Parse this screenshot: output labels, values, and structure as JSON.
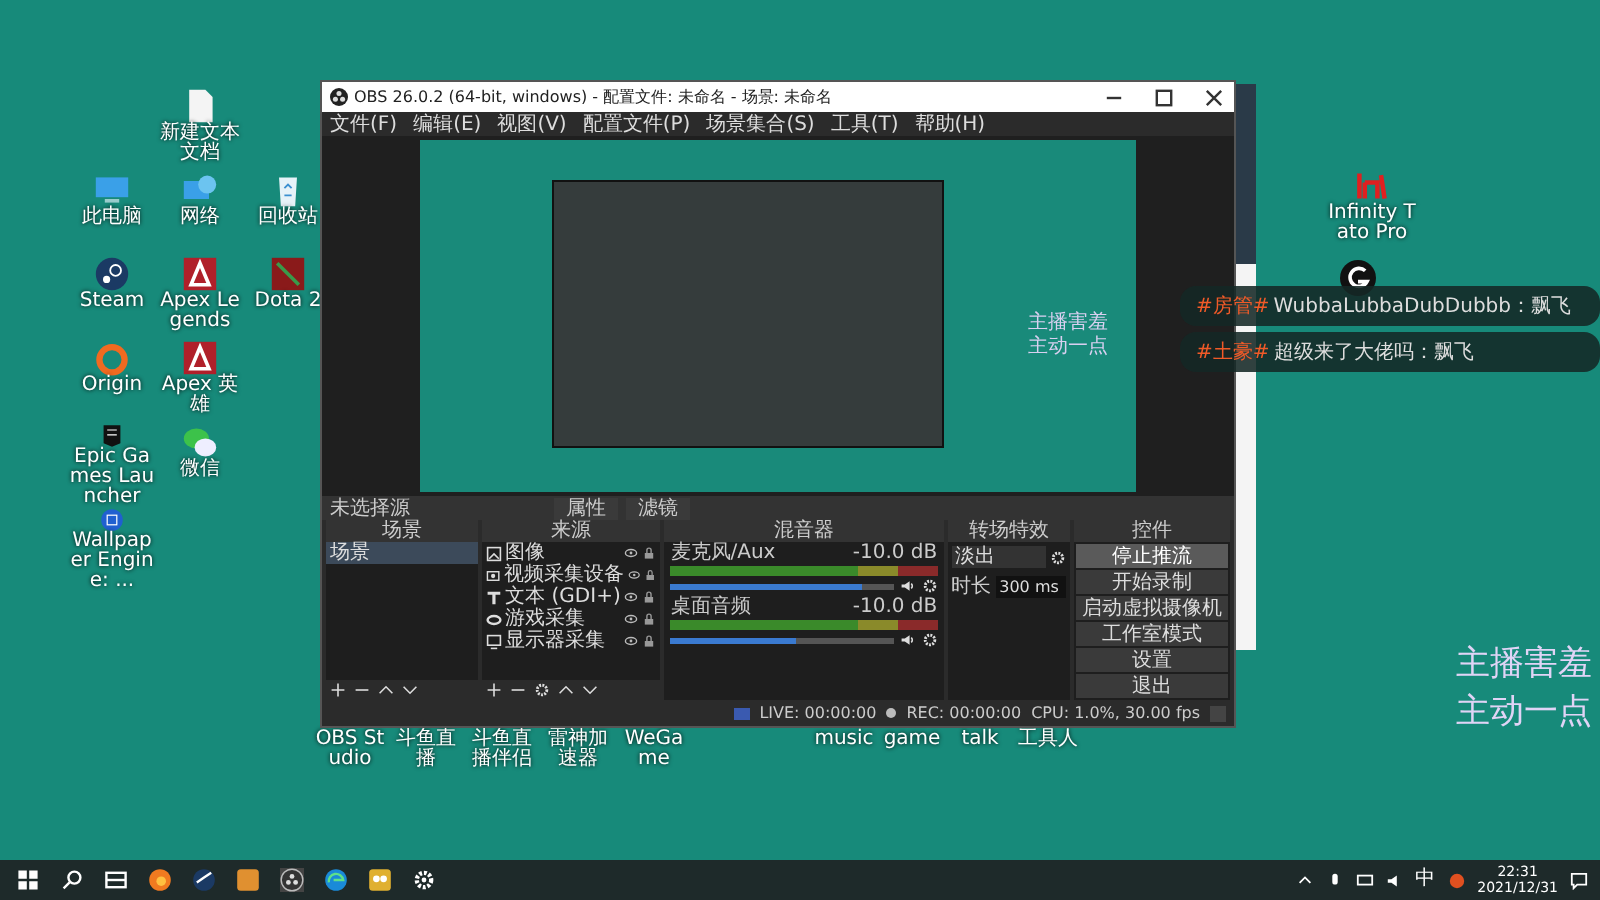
{
  "desktop_icons": [
    {
      "label": "新建文本文档",
      "kind": "file"
    },
    {
      "label": "此电脑",
      "kind": "pc"
    },
    {
      "label": "网络",
      "kind": "network"
    },
    {
      "label": "回收站",
      "kind": "recycle"
    },
    {
      "label": "Steam",
      "kind": "steam"
    },
    {
      "label": "Apex Legends",
      "kind": "apex"
    },
    {
      "label": "Dota 2",
      "kind": "dota"
    },
    {
      "label": "Origin",
      "kind": "origin"
    },
    {
      "label": "Apex 英雄",
      "kind": "apex"
    },
    {
      "label": "Epic Games Launcher",
      "kind": "epic"
    },
    {
      "label": "微信",
      "kind": "wechat"
    },
    {
      "label": "Wallpaper Engine: ...",
      "kind": "wallpaper"
    }
  ],
  "right_icons": [
    {
      "label": "Infinity Tato Pro",
      "kind": "itp"
    },
    {
      "kind": "ghub"
    }
  ],
  "bottom_labels_left": [
    "OBS Studio",
    "斗鱼直播",
    "斗鱼直播伴侣",
    "雷神加速器",
    "WeGame"
  ],
  "bottom_labels_right": [
    "music",
    "game",
    "talk",
    "工具人"
  ],
  "obs": {
    "title": "OBS 26.0.2 (64-bit, windows) - 配置文件: 未命名 - 场景: 未命名",
    "menu": [
      "文件(F)",
      "编辑(E)",
      "视图(V)",
      "配置文件(P)",
      "场景集合(S)",
      "工具(T)",
      "帮助(H)"
    ],
    "preview_lines": [
      "主播害羞",
      "主动一点"
    ],
    "no_source": "未选择源",
    "dock_tabs": [
      "属性",
      "滤镜"
    ],
    "headers": [
      "场景",
      "来源",
      "混音器",
      "转场特效",
      "控件"
    ],
    "scenes": [
      {
        "name": "场景",
        "selected": true
      }
    ],
    "sources": [
      {
        "name": "图像",
        "kind": "image"
      },
      {
        "name": "视频采集设备",
        "kind": "camera"
      },
      {
        "name": "文本 (GDI+)",
        "kind": "text"
      },
      {
        "name": "游戏采集",
        "kind": "game"
      },
      {
        "name": "显示器采集",
        "kind": "monitor"
      }
    ],
    "mixer": [
      {
        "name": "麦克风/Aux",
        "reading": "-10.0 dB",
        "level": 0.86
      },
      {
        "name": "桌面音频",
        "reading": "-10.0 dB",
        "level": 0.56
      }
    ],
    "transition": {
      "value": "淡出",
      "duration_label": "时长",
      "duration": "300 ms"
    },
    "controls": [
      {
        "label": "停止推流",
        "active": true
      },
      {
        "label": "开始录制",
        "active": false
      },
      {
        "label": "启动虚拟摄像机",
        "active": false
      },
      {
        "label": "工作室模式",
        "active": false
      },
      {
        "label": "设置",
        "active": false
      },
      {
        "label": "退出",
        "active": false
      }
    ],
    "status": {
      "live": "LIVE: 00:00:00",
      "rec": "REC: 00:00:00",
      "cpu": "CPU: 1.0%, 30.00 fps"
    }
  },
  "chat": [
    {
      "tag": "#房管#",
      "message": "WubbaLubbaDubDubbb：飘飞"
    },
    {
      "tag": "#土豪#",
      "message": "超级来了大佬吗：飘飞"
    }
  ],
  "overlay_lines": [
    "主播害羞",
    "主动一点"
  ],
  "taskbar": {
    "apps": [
      {
        "kind": "search"
      },
      {
        "kind": "taskview"
      },
      {
        "kind": "firefox"
      },
      {
        "kind": "steam"
      },
      {
        "kind": "box"
      },
      {
        "kind": "obs"
      },
      {
        "kind": "edge"
      },
      {
        "kind": "owl"
      },
      {
        "kind": "settings"
      }
    ],
    "ime": "中",
    "time": "22:31",
    "date": "2021/12/31"
  }
}
